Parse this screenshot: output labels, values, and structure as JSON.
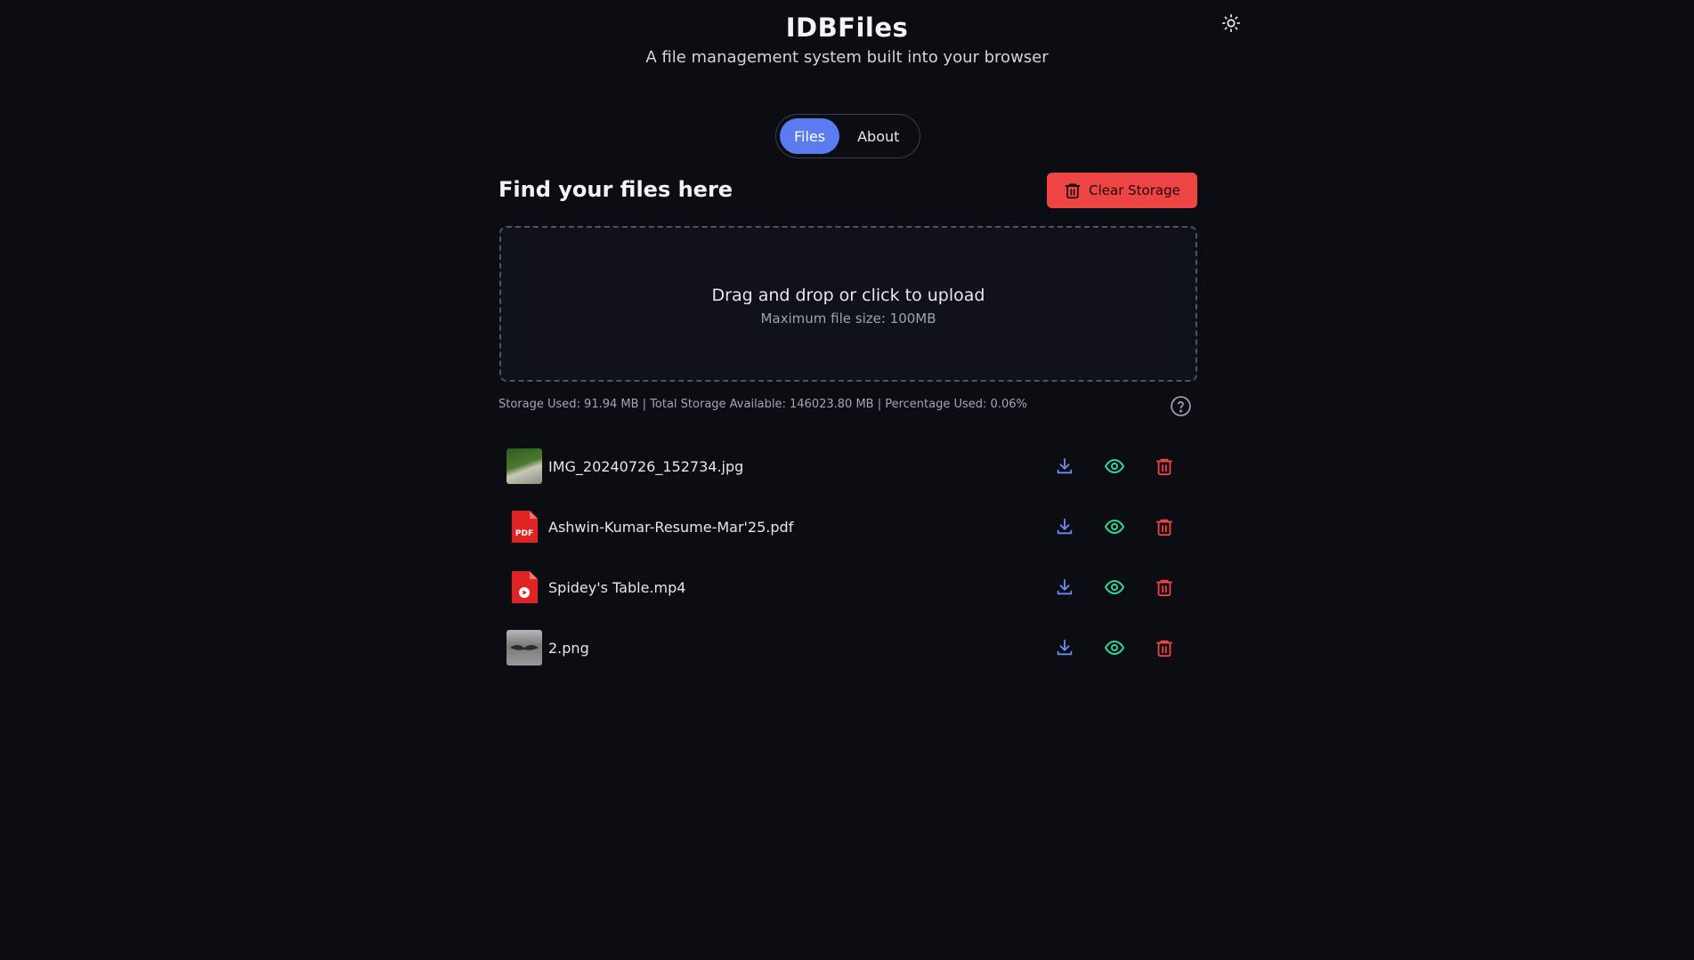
{
  "header": {
    "title": "IDBFiles",
    "subtitle": "A file management system built into your browser",
    "theme_icon": "sun-icon"
  },
  "tabs": [
    {
      "label": "Files",
      "active": true
    },
    {
      "label": "About",
      "active": false
    }
  ],
  "main": {
    "heading": "Find your files here",
    "clear_button_label": "Clear Storage",
    "clear_icon": "trash-icon"
  },
  "dropzone": {
    "title": "Drag and drop or click to upload",
    "subtitle": "Maximum file size: 100MB"
  },
  "storage": {
    "info": "Storage Used: 91.94 MB | Total Storage Available: 146023.80 MB | Percentage Used: 0.06%",
    "help_icon": "help-icon"
  },
  "files": [
    {
      "name": "IMG_20240726_152734.jpg",
      "type": "image"
    },
    {
      "name": "Ashwin-Kumar-Resume-Mar'25.pdf",
      "type": "pdf"
    },
    {
      "name": "Spidey's Table.mp4",
      "type": "video"
    },
    {
      "name": "2.png",
      "type": "image"
    }
  ],
  "file_type_labels": {
    "pdf": "PDF"
  },
  "colors": {
    "accent": "#5b7cf0",
    "danger": "#ef4444",
    "download": "#6b8af5",
    "view": "#34d399",
    "delete": "#ef4444",
    "background": "#0b0d12"
  }
}
